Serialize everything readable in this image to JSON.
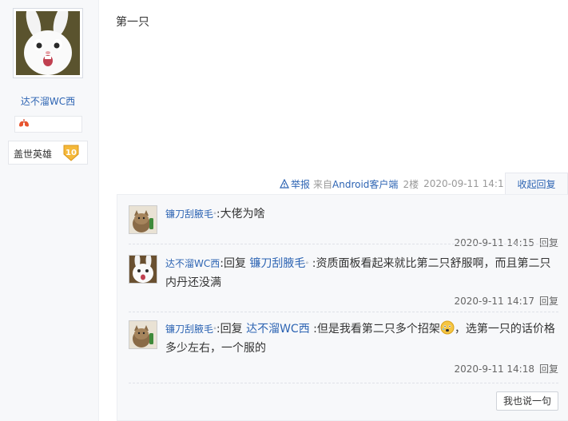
{
  "author": {
    "name": "达不溜WC西",
    "title": "盖世英雄",
    "level": "10"
  },
  "post": {
    "content": "第一只",
    "report_label": "举报",
    "source_prefix": "来自",
    "source_client": "Android客户端",
    "floor": "2楼",
    "time": "2020-09-11 14:11",
    "collapse_label": "收起回复"
  },
  "replies": [
    {
      "user": "镰刀刮腋毛",
      "hat": "ᐤ",
      "sep": ":",
      "text": "大佬为啥",
      "time": "2020-9-11 14:15",
      "reply_label": "回复"
    },
    {
      "user": "达不溜WC西",
      "sep": ":",
      "reply_word": "回复",
      "target": "镰刀刮腋毛",
      "hat": "ᐤ",
      "sep2": ":",
      "text": "资质面板看起来就比第二只舒服啊，而且第二只内丹还没满",
      "time": "2020-9-11 14:17",
      "reply_label": "回复"
    },
    {
      "user": "镰刀刮腋毛",
      "hat": "ᐤ",
      "sep": ":",
      "reply_word": "回复",
      "target": "达不溜WC西",
      "sep2": ":",
      "text_a": "但是我看第二只多个招架",
      "text_b": "，选第一只的话价格多少左右，一个服的",
      "time": "2020-9-11 14:18",
      "reply_label": "回复"
    }
  ],
  "say_button": "我也说一句",
  "colors": {
    "link": "#2d64b3",
    "sidebar_bg": "#f7f8fa",
    "reply_bg": "#f7f8fa"
  }
}
